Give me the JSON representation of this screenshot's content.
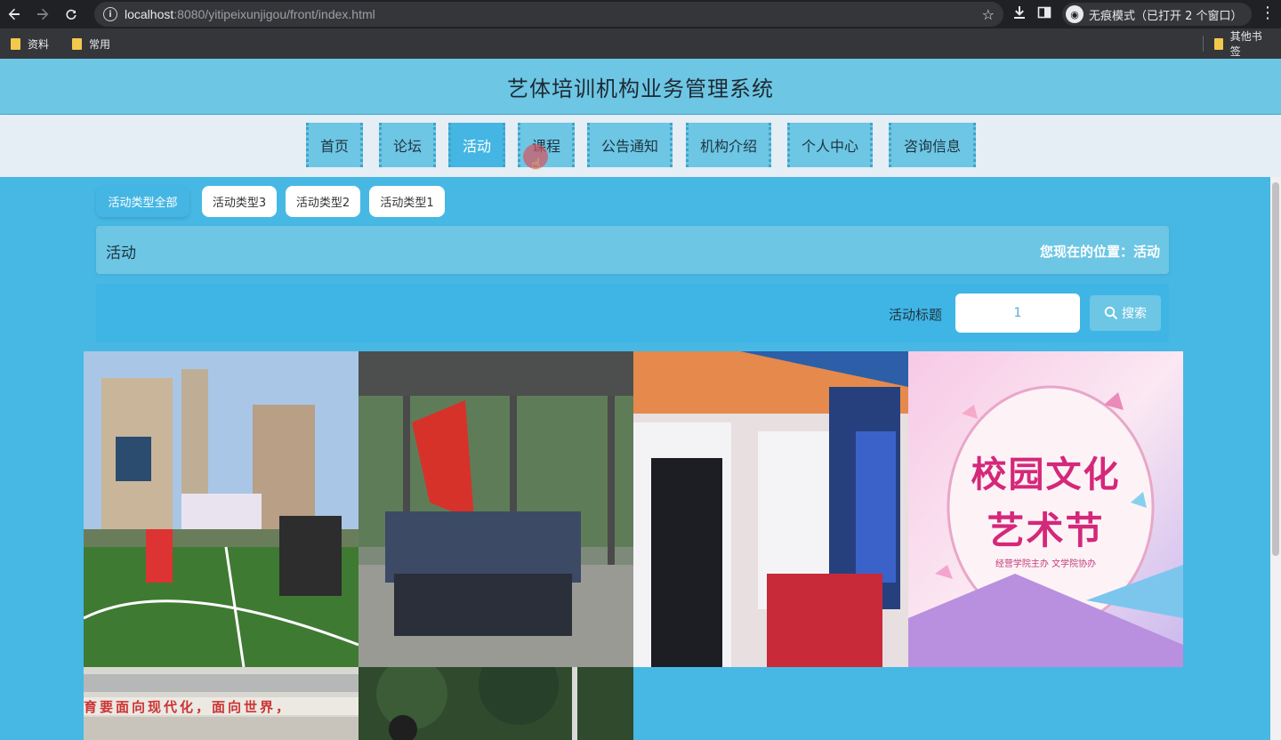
{
  "browser": {
    "url_host": "localhost",
    "url_rest": ":8080/yitipeixunjigou/front/index.html",
    "incognito_label": "无痕模式（已打开 2 个窗口）",
    "bookmarks": [
      "资料",
      "常用"
    ],
    "other_bookmarks": "其他书签"
  },
  "site": {
    "title": "艺体培训机构业务管理系统"
  },
  "nav": {
    "items": [
      {
        "label": "首页"
      },
      {
        "label": "论坛"
      },
      {
        "label": "活动",
        "active": true
      },
      {
        "label": "课程"
      },
      {
        "label": "公告通知"
      },
      {
        "label": "机构介绍"
      },
      {
        "label": "个人中心"
      },
      {
        "label": "咨询信息"
      }
    ]
  },
  "categories": [
    {
      "label": "活动类型全部",
      "active": true
    },
    {
      "label": "活动类型3"
    },
    {
      "label": "活动类型2"
    },
    {
      "label": "活动类型1"
    }
  ],
  "crumb": {
    "title": "活动",
    "location": "您现在的位置：活动"
  },
  "search": {
    "label": "活动标题",
    "value": "1",
    "button": "搜索"
  },
  "cards": [
    {
      "name": "sports-field-photo"
    },
    {
      "name": "group-with-flag-photo"
    },
    {
      "name": "students-at-booth-photo"
    },
    {
      "name": "campus-culture-art-festival-poster",
      "poster_line1": "校园文化",
      "poster_line2": "艺术节",
      "poster_sub": "经营学院主办 文学院协办"
    },
    {
      "name": "school-building-banner-photo",
      "banner": "育要面向现代化，面向世界，"
    },
    {
      "name": "trees-photo"
    }
  ],
  "colors": {
    "page_bg": "#47b8e4",
    "header_bg": "#6dc6e4",
    "nav_active": "#45b6e3"
  }
}
